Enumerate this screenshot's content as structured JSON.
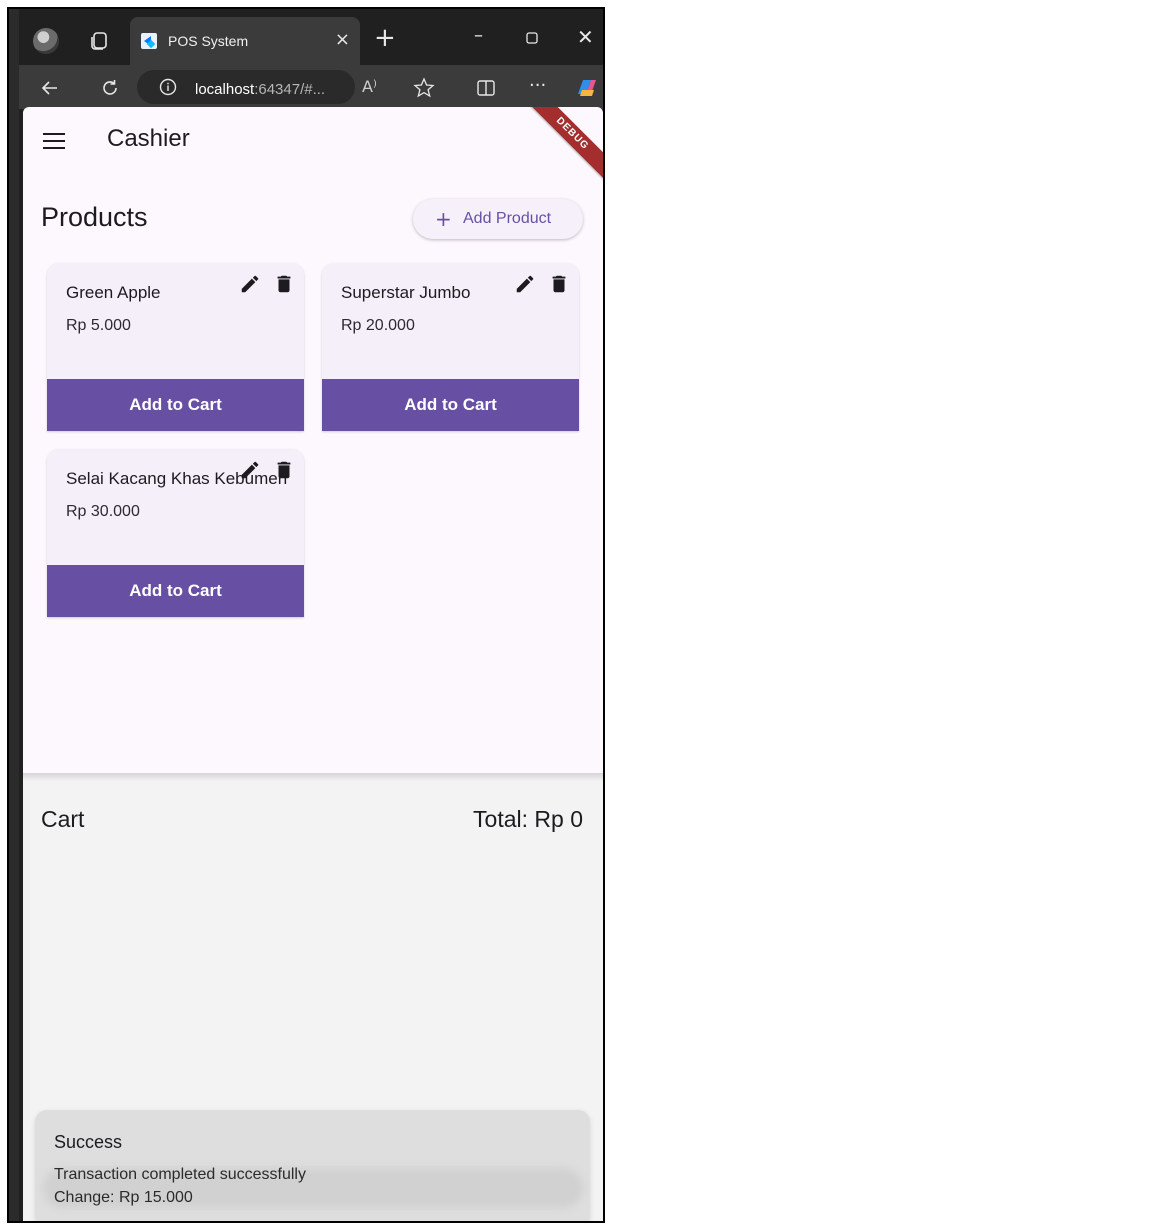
{
  "browser": {
    "tab_title": "POS System",
    "url_host": "localhost",
    "url_rest": ":64347/#...",
    "read_aloud": "A⁾"
  },
  "app": {
    "title": "Cashier",
    "debug_label": "DEBUG",
    "products_heading": "Products",
    "add_product_label": "Add Product",
    "add_product_plus": "+",
    "products": [
      {
        "name": "Green Apple",
        "price": "Rp 5.000",
        "button": "Add to Cart"
      },
      {
        "name": "Superstar Jumbo",
        "price": "Rp 20.000",
        "button": "Add to Cart"
      },
      {
        "name": "Selai Kacang Khas Kebumen",
        "price": "Rp 30.000",
        "button": "Add to Cart"
      }
    ],
    "cart": {
      "heading": "Cart",
      "total": "Total: Rp 0"
    },
    "toast": {
      "title": "Success",
      "line1": "Transaction completed successfully",
      "line2": "Change: Rp 15.000"
    }
  },
  "colors": {
    "primary": "#6750a4",
    "surface": "#fdf7fe",
    "card": "#f4eff9"
  }
}
